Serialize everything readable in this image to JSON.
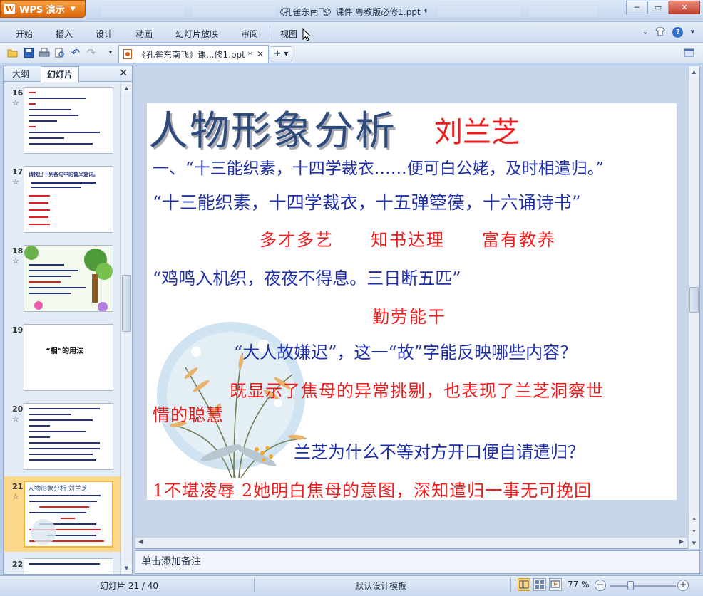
{
  "app": {
    "name": "WPS 演示",
    "logo_glyph": "W",
    "window_title": "《孔雀东南飞》课件 粤教版必修1.ppt *",
    "window_controls": {
      "minimize": "─",
      "restore": "▭",
      "close": "✕"
    }
  },
  "menu": {
    "items": [
      "开始",
      "插入",
      "设计",
      "动画",
      "幻灯片放映",
      "审阅",
      "视图"
    ],
    "help": "?"
  },
  "toolbar": {
    "icons": [
      "open-folder-icon",
      "save-icon",
      "print-icon",
      "print-preview-icon",
      "undo-icon",
      "redo-icon",
      "customize-dropdown-icon"
    ]
  },
  "doc_tab": {
    "label": "《孔雀东南飞》课...修1.ppt *",
    "close": "✕",
    "new_tab": "+"
  },
  "left_panel": {
    "tabs": [
      "大纲",
      "幻灯片"
    ],
    "active_tab": "幻灯片",
    "close": "✕",
    "thumbnails": [
      {
        "number": "16",
        "star": "☆"
      },
      {
        "number": "17",
        "star": "☆",
        "title": "请找出下列各句中的偏义复词。"
      },
      {
        "number": "18",
        "star": "☆"
      },
      {
        "number": "19",
        "star": "",
        "title": "“相”的用法"
      },
      {
        "number": "20",
        "star": "☆"
      },
      {
        "number": "21",
        "star": "☆",
        "title": "人物形象分析 刘兰芝",
        "selected": true
      },
      {
        "number": "22",
        "star": ""
      }
    ]
  },
  "slide": {
    "title": "人物形象分析",
    "name": "刘兰芝",
    "lines": [
      {
        "text": "一、“十三能织素，十四学裁衣……便可白公姥，及时相遣归。”",
        "color": "blue"
      },
      {
        "text": "“十三能织素，十四学裁衣，十五弹箜篌，十六诵诗书”",
        "color": "blue"
      },
      {
        "text": "多才多艺　　知书达理　　富有教养",
        "color": "red"
      },
      {
        "text": "“鸡鸣入机织，夜夜不得息。三日断五匹”",
        "color": "blue"
      },
      {
        "text": "勤劳能干",
        "color": "red"
      },
      {
        "text": "“大人故嫌迟”，这一“故”字能反映哪些内容？",
        "color": "blue"
      },
      {
        "text": "既显示了焦母的异常挑剔，也表现了兰芝洞察世",
        "color": "red"
      },
      {
        "text": "情的聪慧",
        "color": "red"
      },
      {
        "text": "兰芝为什么不等对方开口便自请遣归？",
        "color": "blue"
      },
      {
        "text": "1不堪凌辱 2她明白焦母的意图，深知遣归一事无可挽回",
        "color": "red"
      }
    ]
  },
  "notes": {
    "placeholder": "单击添加备注"
  },
  "status": {
    "slide_counter": "幻灯片 21 / 40",
    "template": "默认设计模板",
    "zoom": "77 %",
    "zoom_level": 0.77
  },
  "colors": {
    "accent_orange": "#e8740c",
    "slide_blue": "#1f2fa8",
    "slide_red": "#ee1c1c",
    "selection": "#fbd88a"
  }
}
